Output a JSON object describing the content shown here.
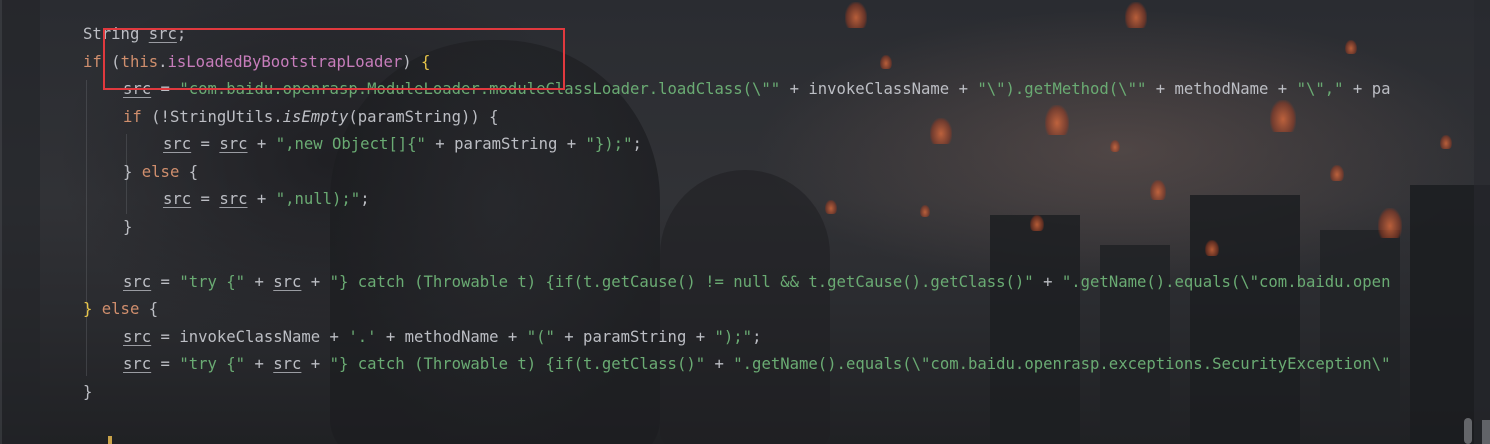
{
  "editor": {
    "lines": [
      {
        "id": "l1",
        "tokens": [
          [
            "p",
            "String "
          ],
          [
            "u",
            "src"
          ],
          [
            "p",
            ";"
          ]
        ]
      },
      {
        "id": "l2",
        "tokens": [
          [
            "k",
            "if "
          ],
          [
            "p",
            "("
          ],
          [
            "k",
            "this"
          ],
          [
            "p",
            "."
          ],
          [
            "f",
            "isLoadedByBootstrapLoader"
          ],
          [
            "p",
            ") "
          ],
          [
            "b",
            "{"
          ]
        ]
      },
      {
        "id": "l3",
        "tokens": [
          [
            "u",
            "src"
          ],
          [
            "p",
            " = "
          ],
          [
            "s",
            "\"com.baidu.openrasp.ModuleLoader.moduleClassLoader.loadClass(\\\"\""
          ],
          [
            "p",
            " + invokeClassName + "
          ],
          [
            "s",
            "\"\\\").getMethod(\\\"\""
          ],
          [
            "p",
            " + methodName + "
          ],
          [
            "s",
            "\"\\\",\""
          ],
          [
            "p",
            " + pa"
          ]
        ]
      },
      {
        "id": "l4",
        "tokens": [
          [
            "k",
            "if "
          ],
          [
            "p",
            "(!StringUtils."
          ],
          [
            "i",
            "isEmpty"
          ],
          [
            "p",
            "(paramString)) {"
          ]
        ]
      },
      {
        "id": "l5",
        "tokens": [
          [
            "u",
            "src"
          ],
          [
            "p",
            " = "
          ],
          [
            "u",
            "src"
          ],
          [
            "p",
            " + "
          ],
          [
            "s",
            "\",new Object[]{\""
          ],
          [
            "p",
            " + paramString + "
          ],
          [
            "s",
            "\"});\""
          ],
          [
            "p",
            ";"
          ]
        ]
      },
      {
        "id": "l6",
        "tokens": [
          [
            "p",
            "} "
          ],
          [
            "k",
            "else "
          ],
          [
            "p",
            "{"
          ]
        ]
      },
      {
        "id": "l7",
        "tokens": [
          [
            "u",
            "src"
          ],
          [
            "p",
            " = "
          ],
          [
            "u",
            "src"
          ],
          [
            "p",
            " + "
          ],
          [
            "s",
            "\",null);\""
          ],
          [
            "p",
            ";"
          ]
        ]
      },
      {
        "id": "l8",
        "tokens": [
          [
            "p",
            "}"
          ]
        ]
      },
      {
        "id": "l9",
        "tokens": [
          [
            "u",
            "src"
          ],
          [
            "p",
            " = "
          ],
          [
            "s",
            "\"try {\""
          ],
          [
            "p",
            " + "
          ],
          [
            "u",
            "src"
          ],
          [
            "p",
            " + "
          ],
          [
            "s",
            "\"} catch (Throwable t) {if(t.getCause() != null && t.getCause().getClass()\""
          ],
          [
            "p",
            " + "
          ],
          [
            "s",
            "\".getName().equals(\\\"com.baidu.open"
          ]
        ]
      },
      {
        "id": "l10",
        "tokens": [
          [
            "b",
            "}"
          ],
          [
            "p",
            " "
          ],
          [
            "k",
            "else "
          ],
          [
            "p",
            "{"
          ]
        ]
      },
      {
        "id": "l11",
        "tokens": [
          [
            "u",
            "src"
          ],
          [
            "p",
            " = invokeClassName + "
          ],
          [
            "s",
            "'.'"
          ],
          [
            "p",
            " + methodName + "
          ],
          [
            "s",
            "\"(\""
          ],
          [
            "p",
            " + paramString + "
          ],
          [
            "s",
            "\");\""
          ],
          [
            "p",
            ";"
          ]
        ]
      },
      {
        "id": "l12",
        "tokens": [
          [
            "u",
            "src"
          ],
          [
            "p",
            " = "
          ],
          [
            "s",
            "\"try {\""
          ],
          [
            "p",
            " + "
          ],
          [
            "u",
            "src"
          ],
          [
            "p",
            " + "
          ],
          [
            "s",
            "\"} catch (Throwable t) {if(t.getClass()\""
          ],
          [
            "p",
            " + "
          ],
          [
            "s",
            "\".getName().equals(\\\"com.baidu.openrasp.exceptions.SecurityException\\\""
          ]
        ]
      },
      {
        "id": "l13",
        "tokens": [
          [
            "p",
            "}"
          ]
        ]
      }
    ]
  },
  "colors": {
    "keyword": "#cf8e6d",
    "string": "#6aab73",
    "field": "#c77dbb",
    "brace_match": "#e6c44a",
    "text": "#bcbec4",
    "annotation_box": "#e0393e"
  }
}
